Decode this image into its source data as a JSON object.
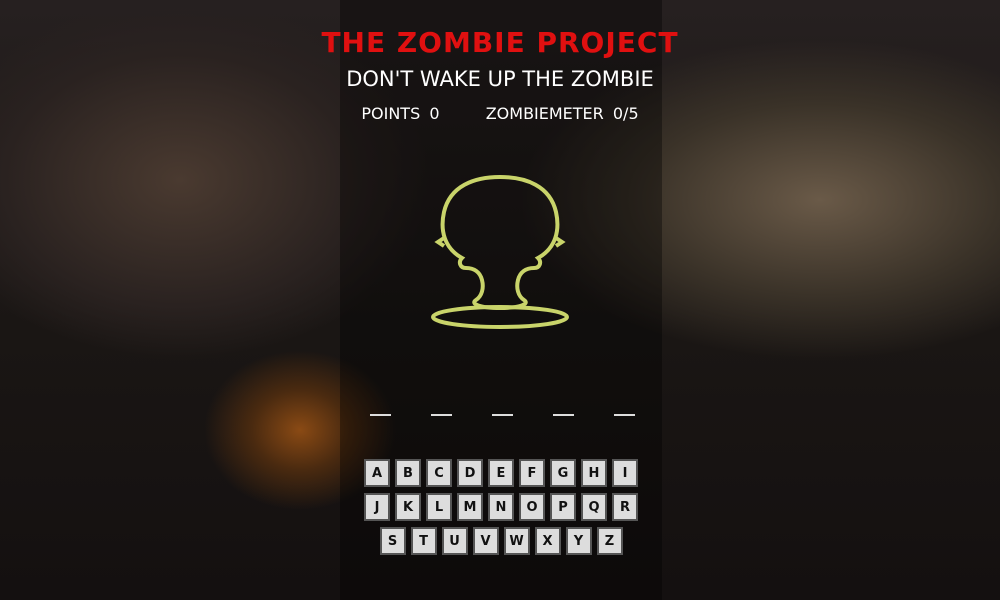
{
  "title": "THE ZOMBIE PROJECT",
  "subtitle": "DON'T WAKE UP THE ZOMBIE",
  "points_label": "POINTS",
  "points": "0",
  "meter_label": "ZOMBIEMETER",
  "meter": "0/5",
  "colors": {
    "title": "#e01010",
    "zombie": "#c9d46a",
    "key": "#dddddd"
  },
  "word_blanks": 5,
  "keys": [
    [
      "A",
      "B",
      "C",
      "D",
      "E",
      "F",
      "G",
      "H",
      "I"
    ],
    [
      "J",
      "K",
      "L",
      "M",
      "N",
      "O",
      "P",
      "Q",
      "R"
    ],
    [
      "S",
      "T",
      "U",
      "V",
      "W",
      "X",
      "Y",
      "Z"
    ]
  ]
}
